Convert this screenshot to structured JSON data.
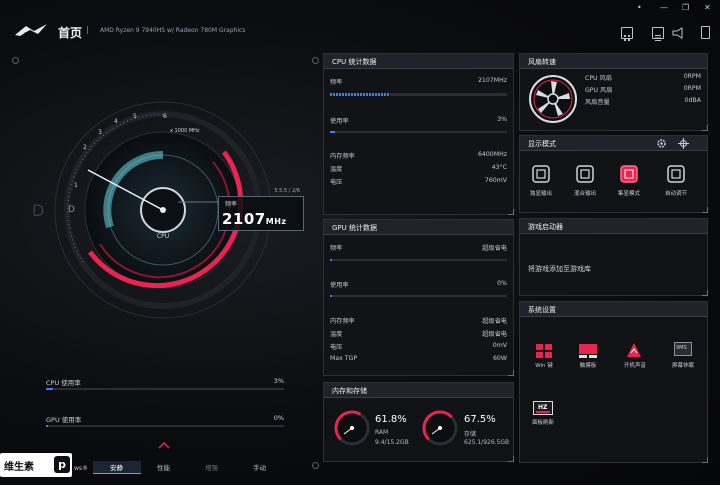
{
  "header": {
    "home_label": "首页",
    "cpu_name": "AMD Ryzen 9 7940HS w/ Radeon 780M Graphics",
    "window_controls": [
      "•",
      "—",
      "❐",
      "✕"
    ]
  },
  "gauge": {
    "ticks": [
      "1",
      "2",
      "3",
      "4",
      "5",
      "6"
    ],
    "scale_label": "x 1000 MHz",
    "center_label": "CPU",
    "side_letter_d": "D",
    "side_letter_o": "D",
    "readout_label": "频率",
    "readout_version": "5.5.5 / 2/6",
    "readout_value": "2107",
    "readout_unit": "MHz"
  },
  "left_usage": [
    {
      "label": "CPU 使用率",
      "value": "3%",
      "percent": 3
    },
    {
      "label": "GPU 使用率",
      "value": "0%",
      "percent": 0
    }
  ],
  "modes": {
    "partial_text": "ws®",
    "items": [
      "安静",
      "性能",
      "增强",
      "手动"
    ],
    "active": "安静"
  },
  "watermark": {
    "text": "维生素",
    "badge": "p"
  },
  "cpu_panel": {
    "title": "CPU 统计数据",
    "freq_label": "频率",
    "freq_value": "2107MHz",
    "freq_percent": 34,
    "usage_label": "使用率",
    "usage_value": "3%",
    "usage_percent": 3,
    "mem_freq_label": "内存频率",
    "mem_freq_value": "6400MHz",
    "temp_label": "温度",
    "temp_value": "43°C",
    "voltage_label": "电压",
    "voltage_value": "760mV"
  },
  "gpu_panel": {
    "title": "GPU 统计数据",
    "freq_label": "频率",
    "freq_value": "超级省电",
    "usage_label": "使用率",
    "usage_value": "0%",
    "usage_percent": 0,
    "mem_freq_label": "内存频率",
    "mem_freq_value": "超级省电",
    "temp_label": "温度",
    "temp_value": "超级省电",
    "voltage_label": "电压",
    "voltage_value": "0mV",
    "tgp_label": "Max TGP",
    "tgp_value": "60W"
  },
  "memory_panel": {
    "title": "内存和存储",
    "ram_percent_text": "61.8%",
    "ram_percent": 61.8,
    "ram_label": "RAM",
    "ram_detail": "9.4/15.2GB",
    "storage_percent_text": "67.5%",
    "storage_percent": 67.5,
    "storage_label": "存储",
    "storage_detail": "625.1/926.5GB"
  },
  "fan_panel": {
    "title": "风扇转速",
    "rows": [
      {
        "label": "CPU 风扇",
        "value": "0RPM"
      },
      {
        "label": "GPU 风扇",
        "value": "0RPM"
      },
      {
        "label": "风扇音量",
        "value": "0dBA"
      }
    ]
  },
  "display_panel": {
    "title": "显示模式",
    "items": [
      {
        "label": "独显输出",
        "icon": "gpu-chip-icon"
      },
      {
        "label": "混合输出",
        "icon": "gpu-chip-icon"
      },
      {
        "label": "集显模式",
        "icon": "gpu-chip-icon"
      },
      {
        "label": "自动调节",
        "icon": "gpu-chip-icon"
      }
    ],
    "active_index": 2
  },
  "game_panel": {
    "title": "游戏启动器",
    "text": "将游戏添加至游戏库"
  },
  "system_panel": {
    "title": "系统设置",
    "items": [
      {
        "label": "Win 键"
      },
      {
        "label": "触摸板"
      },
      {
        "label": "开机声音"
      },
      {
        "label": "屏幕休眠"
      },
      {
        "label": "面板刷新"
      }
    ],
    "refresh_badge": "HZ",
    "sleep_badge": "9MS"
  },
  "colors": {
    "accent_red": "#e8244f",
    "accent_blue": "#3d7cf4",
    "accent_cyan": "#6fd3e0"
  }
}
